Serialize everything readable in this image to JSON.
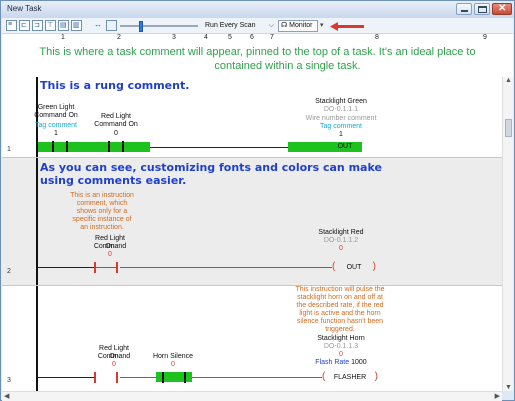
{
  "window": {
    "title": "New Task",
    "close_glyph": "✕"
  },
  "toolbar": {
    "icons": [
      "rung-icon",
      "branch-icon",
      "branch-level-icon",
      "contact-icon",
      "coil-icon",
      "function-icon",
      "jump-icon",
      "ladder-view-icon"
    ],
    "scan_mode": "Run Every Scan",
    "monitor_label": "Monitor",
    "accent": "#2f7ae5",
    "annotation_arrow_color": "#d93a2b"
  },
  "ruler": {
    "columns": [
      "1",
      "2",
      "3",
      "4",
      "5",
      "6",
      "7",
      "8",
      "9"
    ]
  },
  "task_comment": {
    "line1": "This is where a task comment will appear, pinned to the top of a task.  It's an ideal place to",
    "line2": "contained within a single task.",
    "color": "#2ea24a"
  },
  "rungs": [
    {
      "number": "1",
      "comment": "This is a rung comment.",
      "contact1": {
        "name": "Green Light Command On",
        "tag_comment": "Tag comment",
        "value": "1"
      },
      "contact2": {
        "name": "Red Light Command On",
        "value": "0"
      },
      "output": {
        "name": "Stacklight Green",
        "address": "DO-0.1.1.1",
        "wire_comment": "Wire number comment",
        "tag_comment": "Tag comment",
        "value": "1",
        "instruction": "OUT"
      }
    },
    {
      "number": "2",
      "comment_line1": "As you can see, customizing fonts and colors can make",
      "comment_line2": "using comments easier.",
      "instruction_comment": [
        "This is an instruction",
        "comment, which",
        "shows only for a",
        "specific instance of",
        "an instruction."
      ],
      "contact1": {
        "name": "Red Light Command",
        "state": "On",
        "value": "0"
      },
      "output": {
        "name": "Stacklight Red",
        "address": "DO-0.1.1.2",
        "value": "0",
        "instruction": "OUT"
      }
    },
    {
      "number": "3",
      "instruction_comment": [
        "This instruction will pulse the",
        "stacklight horn on and off at",
        "the described rate, if the red",
        "light is active and the horn",
        "silence function hasn't been",
        "triggered."
      ],
      "contact1": {
        "name": "Red Light Command",
        "state": "On",
        "value": "0"
      },
      "contact2": {
        "name": "Horn Silence",
        "value": "0"
      },
      "output": {
        "name": "Stacklight Horn",
        "address": "DO-0.1.1.3",
        "value": "0",
        "param_label": "Flash Rate",
        "param_value": "1000",
        "instruction": "FLASHER"
      }
    }
  ],
  "colors": {
    "powered": "#1ec21e",
    "unpowered": "#d93a2b",
    "rung_comment": "#1f3fcf",
    "instr_comment": "#d46a1e"
  }
}
